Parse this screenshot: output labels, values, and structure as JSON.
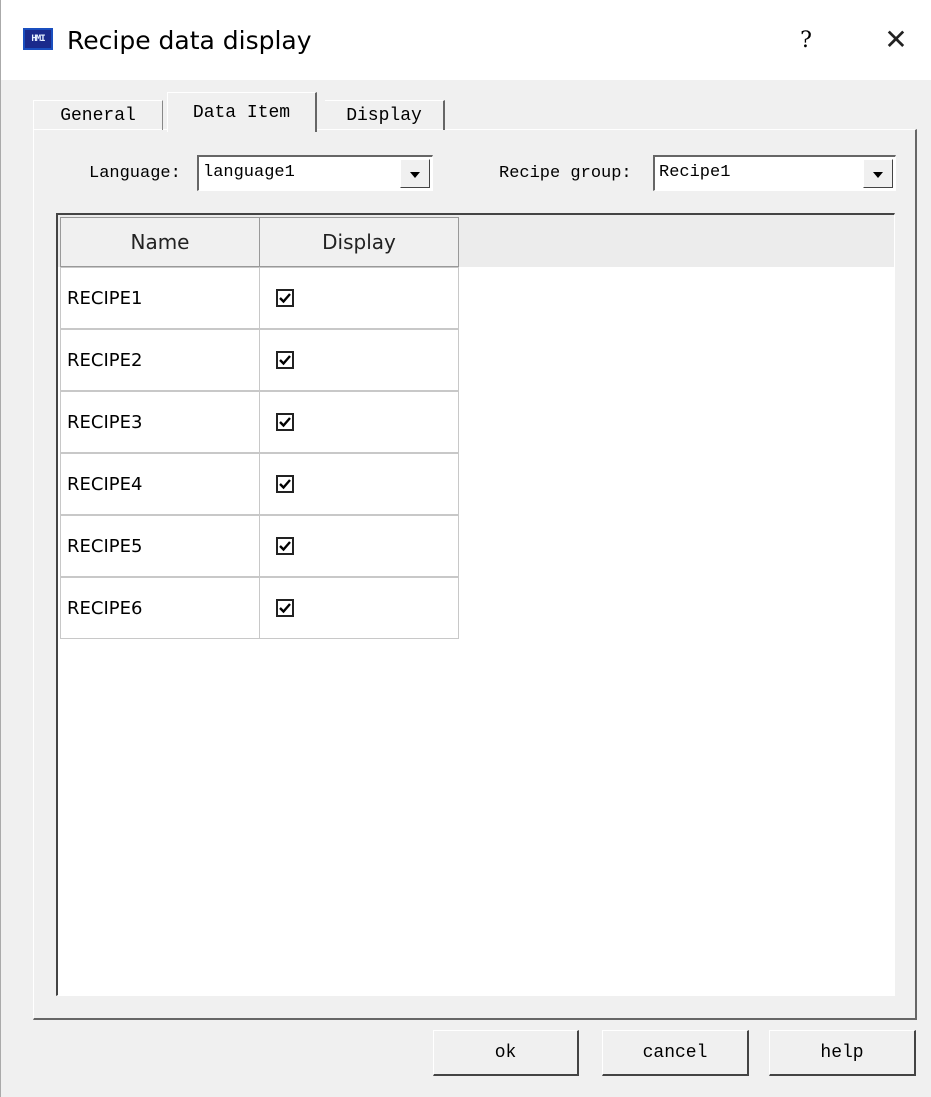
{
  "window": {
    "title": "Recipe data display",
    "icon": "hmi-app-icon",
    "icon_label": "HMI",
    "help_glyph": "?",
    "close_glyph": "✕"
  },
  "tabs": [
    {
      "label": "General",
      "active": false
    },
    {
      "label": "Data Item",
      "active": true
    },
    {
      "label": "Display",
      "active": false
    }
  ],
  "language": {
    "label": "Language:",
    "value": "language1"
  },
  "recipe_group": {
    "label": "Recipe group:",
    "value": "Recipe1"
  },
  "table": {
    "columns": [
      "Name",
      "Display"
    ],
    "rows": [
      {
        "name": "RECIPE1",
        "display": true
      },
      {
        "name": "RECIPE2",
        "display": true
      },
      {
        "name": "RECIPE3",
        "display": true
      },
      {
        "name": "RECIPE4",
        "display": true
      },
      {
        "name": "RECIPE5",
        "display": true
      },
      {
        "name": "RECIPE6",
        "display": true
      }
    ]
  },
  "buttons": {
    "ok": "ok",
    "cancel": "cancel",
    "help": "help"
  }
}
